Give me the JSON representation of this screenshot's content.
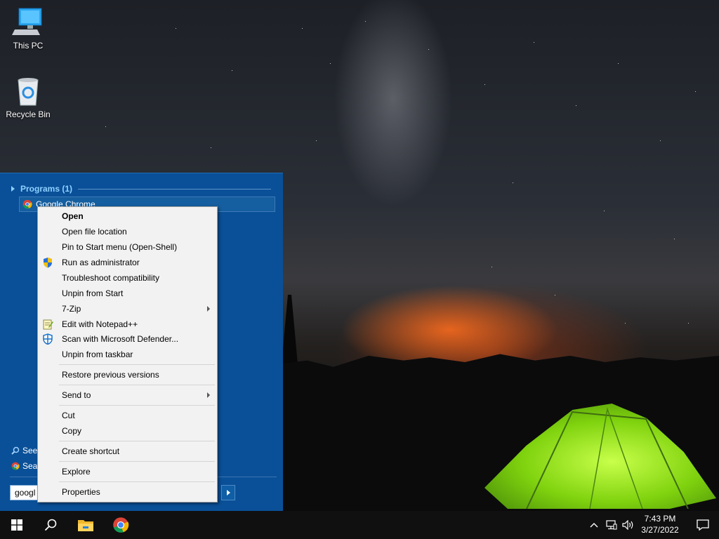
{
  "desktop": {
    "icons": [
      {
        "label": "This PC",
        "icon": "computer-icon"
      },
      {
        "label": "Recycle Bin",
        "icon": "recycle-bin-icon"
      }
    ]
  },
  "start_menu": {
    "programs_header": "Programs (1)",
    "program_item": "Google Chrome",
    "see_more": "See",
    "search_web": "Sear",
    "search_value": "googl"
  },
  "context_menu": {
    "items": [
      {
        "label": "Open",
        "bold": true
      },
      {
        "label": "Open file location"
      },
      {
        "label": "Pin to Start menu (Open-Shell)"
      },
      {
        "label": "Run as administrator",
        "icon": "uac-shield-icon"
      },
      {
        "label": "Troubleshoot compatibility"
      },
      {
        "label": "Unpin from Start"
      },
      {
        "label": "7-Zip",
        "submenu": true
      },
      {
        "label": "Edit with Notepad++",
        "icon": "notepad-plus-plus-icon"
      },
      {
        "label": "Scan with Microsoft Defender...",
        "icon": "defender-icon"
      },
      {
        "label": "Unpin from taskbar"
      },
      {
        "label": "Restore previous versions"
      },
      {
        "label": "Send to",
        "submenu": true
      },
      {
        "label": "Cut"
      },
      {
        "label": "Copy"
      },
      {
        "label": "Create shortcut"
      },
      {
        "label": "Explore"
      },
      {
        "label": "Properties"
      }
    ]
  },
  "taskbar": {
    "pinned": [
      "start-icon",
      "search-icon",
      "file-explorer-icon",
      "chrome-icon"
    ],
    "clock_time": "7:43 PM",
    "clock_date": "3/27/2022"
  },
  "colors": {
    "start_menu_bg": "#0a5098",
    "programs_header": "#8fd0ff",
    "context_menu_bg": "#f2f2f2",
    "taskbar_bg": "#101010"
  }
}
